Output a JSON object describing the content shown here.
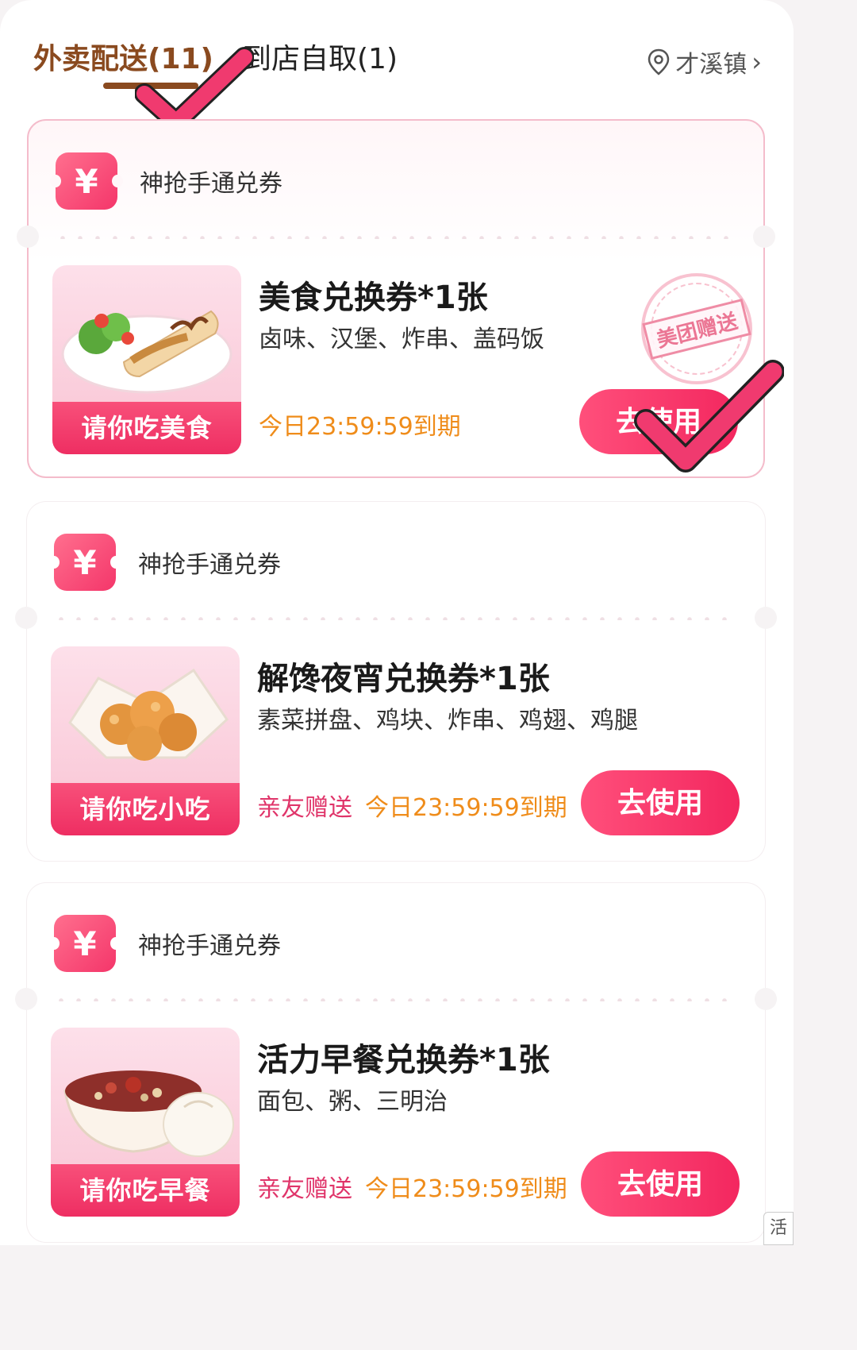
{
  "tabs": {
    "delivery_label": "外卖配送(11)",
    "pickup_label": "到店自取(1)",
    "location": "才溪镇"
  },
  "colors": {
    "accent": "#f3275f",
    "tab_active": "#8a4a1f",
    "expiry": "#ef8c1a",
    "gift": "#e0356a"
  },
  "coupons": [
    {
      "brand_icon": "¥",
      "brand_name": "神抢手通兑券",
      "title": "美食兑换券*1张",
      "desc": "卤味、汉堡、炸串、盖码饭",
      "thumb_label": "请你吃美食",
      "thumb_icon": "wrap-food-image",
      "gift": "",
      "expiry": "今日23:59:59到期",
      "button": "去使用",
      "stamp": "美团赠送"
    },
    {
      "brand_icon": "¥",
      "brand_name": "神抢手通兑券",
      "title": "解馋夜宵兑换券*1张",
      "desc": "素菜拼盘、鸡块、炸串、鸡翅、鸡腿",
      "thumb_label": "请你吃小吃",
      "thumb_icon": "fried-chicken-image",
      "gift": "亲友赠送",
      "expiry": "今日23:59:59到期",
      "button": "去使用"
    },
    {
      "brand_icon": "¥",
      "brand_name": "神抢手通兑券",
      "title": "活力早餐兑换券*1张",
      "desc": "面包、粥、三明治",
      "thumb_label": "请你吃早餐",
      "thumb_icon": "porridge-bun-image",
      "gift": "亲友赠送",
      "expiry": "今日23:59:59到期",
      "button": "去使用"
    }
  ],
  "side_hint": "活"
}
